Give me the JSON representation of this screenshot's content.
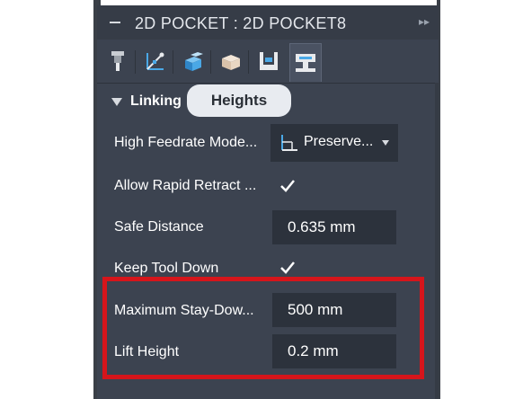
{
  "panel": {
    "title": "2D POCKET : 2D POCKET8",
    "collapse_icon": "minus-icon",
    "expand_icon": "double-chevron-right-icon"
  },
  "tabs": [
    {
      "name": "tool",
      "icon": "tool-icon"
    },
    {
      "name": "geometry",
      "icon": "geometry-icon"
    },
    {
      "name": "heights",
      "icon": "heights-icon"
    },
    {
      "name": "passes",
      "icon": "passes-icon"
    },
    {
      "name": "linking-area",
      "icon": "linking-area-icon"
    },
    {
      "name": "linking",
      "icon": "linking-icon",
      "active": true
    }
  ],
  "section": {
    "label": "Linking",
    "tooltip": "Heights"
  },
  "rows": {
    "high_feedrate": {
      "label": "High Feedrate Mode...",
      "value": "Preserve..."
    },
    "allow_rapid_retract": {
      "label": "Allow Rapid Retract ...",
      "checked": true
    },
    "safe_distance": {
      "label": "Safe Distance",
      "value": "0.635 mm"
    },
    "keep_tool_down": {
      "label": "Keep Tool Down",
      "checked": true
    },
    "maximum_stay_down": {
      "label": "Maximum Stay-Dow...",
      "value": "500 mm"
    },
    "lift_height": {
      "label": "Lift Height",
      "value": "0.2 mm"
    }
  },
  "colors": {
    "panel_bg": "#3c4350",
    "field_bg": "#2c323c",
    "highlight": "#d6151b",
    "tooltip_bg": "#e8ebf0",
    "accent_icon": "#4aa8e6"
  }
}
